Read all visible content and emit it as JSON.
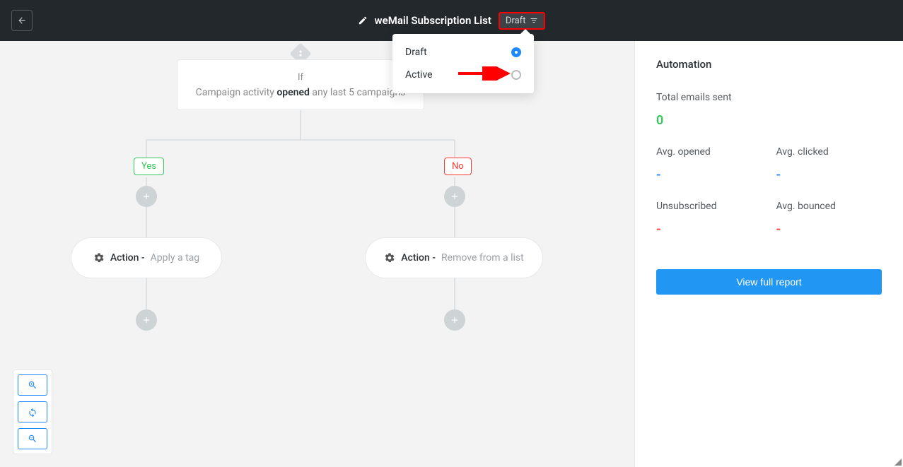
{
  "header": {
    "title": "weMail Subscription List",
    "status_label": "Draft"
  },
  "status_dropdown": {
    "options": [
      {
        "label": "Draft",
        "selected": true
      },
      {
        "label": "Active",
        "selected": false
      }
    ]
  },
  "flow": {
    "condition": {
      "if_label": "If",
      "prefix": "Campaign activity ",
      "bold": "opened",
      "suffix": " any last 5 campaigns"
    },
    "branches": {
      "yes_label": "Yes",
      "no_label": "No"
    },
    "actions": {
      "yes": {
        "label": "Action - ",
        "sub": "Apply a tag"
      },
      "no": {
        "label": "Action - ",
        "sub": "Remove from a list"
      }
    }
  },
  "sidebar": {
    "title": "Automation",
    "total_label": "Total emails sent",
    "total_value": "0",
    "stats": {
      "avg_opened_label": "Avg. opened",
      "avg_opened_value": "-",
      "avg_clicked_label": "Avg. clicked",
      "avg_clicked_value": "-",
      "unsub_label": "Unsubscribed",
      "unsub_value": "-",
      "bounced_label": "Avg. bounced",
      "bounced_value": "-"
    },
    "report_button": "View full report"
  }
}
